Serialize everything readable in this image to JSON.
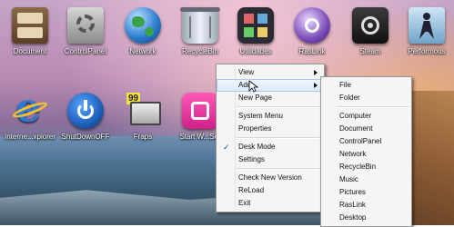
{
  "desktop": {
    "icons_row1": [
      {
        "label": "Document",
        "icon": "document-icon"
      },
      {
        "label": "ControlPanel",
        "icon": "control-panel-icon"
      },
      {
        "label": "Network",
        "icon": "network-globe-icon"
      },
      {
        "label": "RecycleBin",
        "icon": "recycle-bin-icon"
      },
      {
        "label": "Utilidades",
        "icon": "utilities-folder-icon"
      },
      {
        "label": "RasLink",
        "icon": "raslink-icon"
      },
      {
        "label": "Steam",
        "icon": "steam-icon"
      },
      {
        "label": "Performous",
        "icon": "performous-icon"
      }
    ],
    "icons_row2": [
      {
        "label": "Interne...xplorer",
        "icon": "internet-explorer-icon"
      },
      {
        "label": "ShutDownOFF",
        "icon": "power-icon"
      },
      {
        "label": "Fraps",
        "icon": "fraps-icon"
      },
      {
        "label": "Start W...Ser",
        "icon": "start-wamp-icon"
      }
    ]
  },
  "context_menu": {
    "items": [
      {
        "label": "View",
        "submenu": true
      },
      {
        "label": "Add",
        "submenu": true,
        "hovered": true
      },
      {
        "label": "New Page"
      },
      {
        "label": "System Menu"
      },
      {
        "label": "Properties"
      },
      {
        "label": "Desk Mode",
        "checked": true
      },
      {
        "label": "Settings"
      },
      {
        "label": "Check New Version"
      },
      {
        "label": "ReLoad"
      },
      {
        "label": "Exit"
      }
    ],
    "check_glyph": "✓"
  },
  "add_submenu": {
    "items": [
      {
        "label": "File"
      },
      {
        "label": "Folder"
      },
      {
        "label": "Computer"
      },
      {
        "label": "Document"
      },
      {
        "label": "ControlPanel"
      },
      {
        "label": "Network"
      },
      {
        "label": "RecycleBin"
      },
      {
        "label": "Music"
      },
      {
        "label": "Pictures"
      },
      {
        "label": "RasLink"
      },
      {
        "label": "Desktop"
      }
    ]
  },
  "colors": {
    "menu_bg": "#f5f5f5",
    "menu_border": "#979797",
    "hover_highlight": "#dbe9f9",
    "check_color": "#1b58c8"
  }
}
